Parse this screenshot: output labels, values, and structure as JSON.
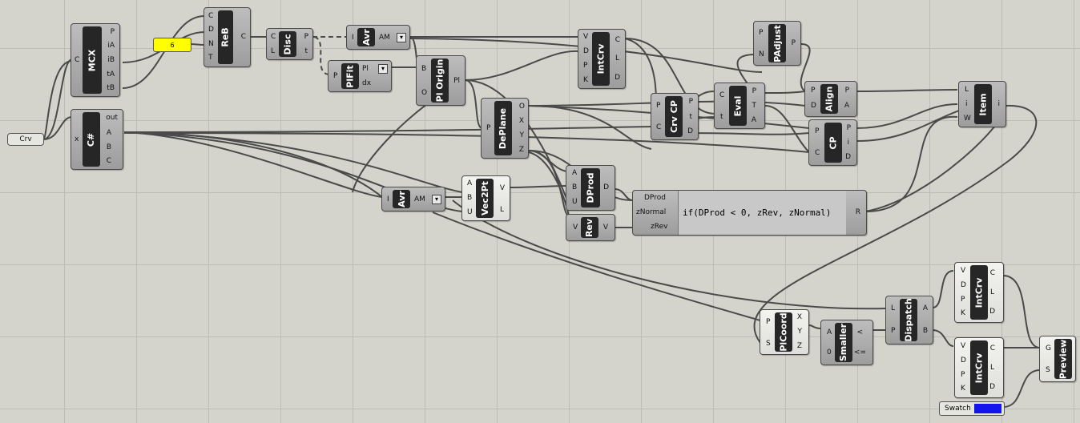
{
  "canvas": {
    "background": "#d4d4cc",
    "wire_color": "#4a4a4a"
  },
  "params": {
    "crv": "Crv",
    "slider": "6",
    "swatch": "Swatch",
    "swatch_color": "#1414ee",
    "slider_color": "#ffff00"
  },
  "components": {
    "mcx": {
      "name": "MCX",
      "inputs": [
        "C"
      ],
      "outputs": [
        "P",
        "iA",
        "iB",
        "tA",
        "tB"
      ]
    },
    "csharp": {
      "name": "C#",
      "inputs": [
        "x"
      ],
      "outputs": [
        "out",
        "A",
        "B",
        "C"
      ]
    },
    "reb": {
      "name": "ReB",
      "inputs": [
        "C",
        "D",
        "N",
        "T"
      ],
      "outputs": [
        "C"
      ]
    },
    "disc": {
      "name": "Disc",
      "inputs": [
        "C",
        "L"
      ],
      "outputs": [
        "P",
        "t"
      ]
    },
    "avr1": {
      "name": "Avr",
      "inputs": [
        "I"
      ],
      "outputs": [
        "AM"
      ]
    },
    "plfit": {
      "name": "PlFit",
      "inputs": [
        "P"
      ],
      "outputs": [
        "Pl",
        "dx"
      ]
    },
    "plorigin": {
      "name": "Pl Origin",
      "inputs": [
        "B",
        "O"
      ],
      "outputs": [
        "Pl"
      ]
    },
    "deplane": {
      "name": "DePlane",
      "inputs": [
        "P"
      ],
      "outputs": [
        "O",
        "X",
        "Y",
        "Z"
      ]
    },
    "avr2": {
      "name": "Avr",
      "inputs": [
        "I"
      ],
      "outputs": [
        "AM"
      ]
    },
    "vec2pt": {
      "name": "Vec2Pt",
      "inputs": [
        "A",
        "B",
        "U"
      ],
      "outputs": [
        "V",
        "L"
      ]
    },
    "intcrv1": {
      "name": "IntCrv",
      "inputs": [
        "V",
        "D",
        "P",
        "K"
      ],
      "outputs": [
        "C",
        "L",
        "D"
      ]
    },
    "crvcp": {
      "name": "Crv CP",
      "inputs": [
        "P",
        "C"
      ],
      "outputs": [
        "P",
        "t",
        "D"
      ]
    },
    "eval": {
      "name": "Eval",
      "inputs": [
        "C",
        "t"
      ],
      "outputs": [
        "P",
        "T",
        "A"
      ]
    },
    "padjust": {
      "name": "PAdjust",
      "inputs": [
        "P",
        "N"
      ],
      "outputs": [
        "P"
      ]
    },
    "align": {
      "name": "Align",
      "inputs": [
        "P",
        "D"
      ],
      "outputs": [
        "P",
        "A"
      ]
    },
    "cp": {
      "name": "CP",
      "inputs": [
        "P",
        "C"
      ],
      "outputs": [
        "P",
        "i",
        "D"
      ]
    },
    "item": {
      "name": "Item",
      "inputs": [
        "L",
        "i",
        "W"
      ],
      "outputs": [
        "i"
      ]
    },
    "dprod": {
      "name": "DProd",
      "inputs": [
        "A",
        "B",
        "U"
      ],
      "outputs": [
        "D"
      ]
    },
    "rev": {
      "name": "Rev",
      "inputs": [
        "V"
      ],
      "outputs": [
        "V"
      ]
    },
    "expression": {
      "inputs": [
        "DProd",
        "zNormal",
        "zRev"
      ],
      "expr": "if(DProd < 0, zRev, zNormal)",
      "outputs": [
        "R"
      ]
    },
    "plcoord": {
      "name": "PlCoord",
      "inputs": [
        "P",
        "S"
      ],
      "outputs": [
        "X",
        "Y",
        "Z"
      ]
    },
    "smaller": {
      "name": "Smaller",
      "inputs": [
        "A",
        "0"
      ],
      "outputs": [
        "<",
        "<="
      ]
    },
    "dispatch": {
      "name": "Dispatch",
      "inputs": [
        "L",
        "P"
      ],
      "outputs": [
        "A",
        "B"
      ]
    },
    "intcrv2": {
      "name": "IntCrv",
      "inputs": [
        "V",
        "D",
        "P",
        "K"
      ],
      "outputs": [
        "C",
        "L",
        "D"
      ]
    },
    "intcrv3": {
      "name": "IntCrv",
      "inputs": [
        "V",
        "D",
        "P",
        "K"
      ],
      "outputs": [
        "C",
        "L",
        "D"
      ]
    },
    "preview": {
      "name": "Preview",
      "inputs": [
        "G",
        "S"
      ]
    }
  }
}
